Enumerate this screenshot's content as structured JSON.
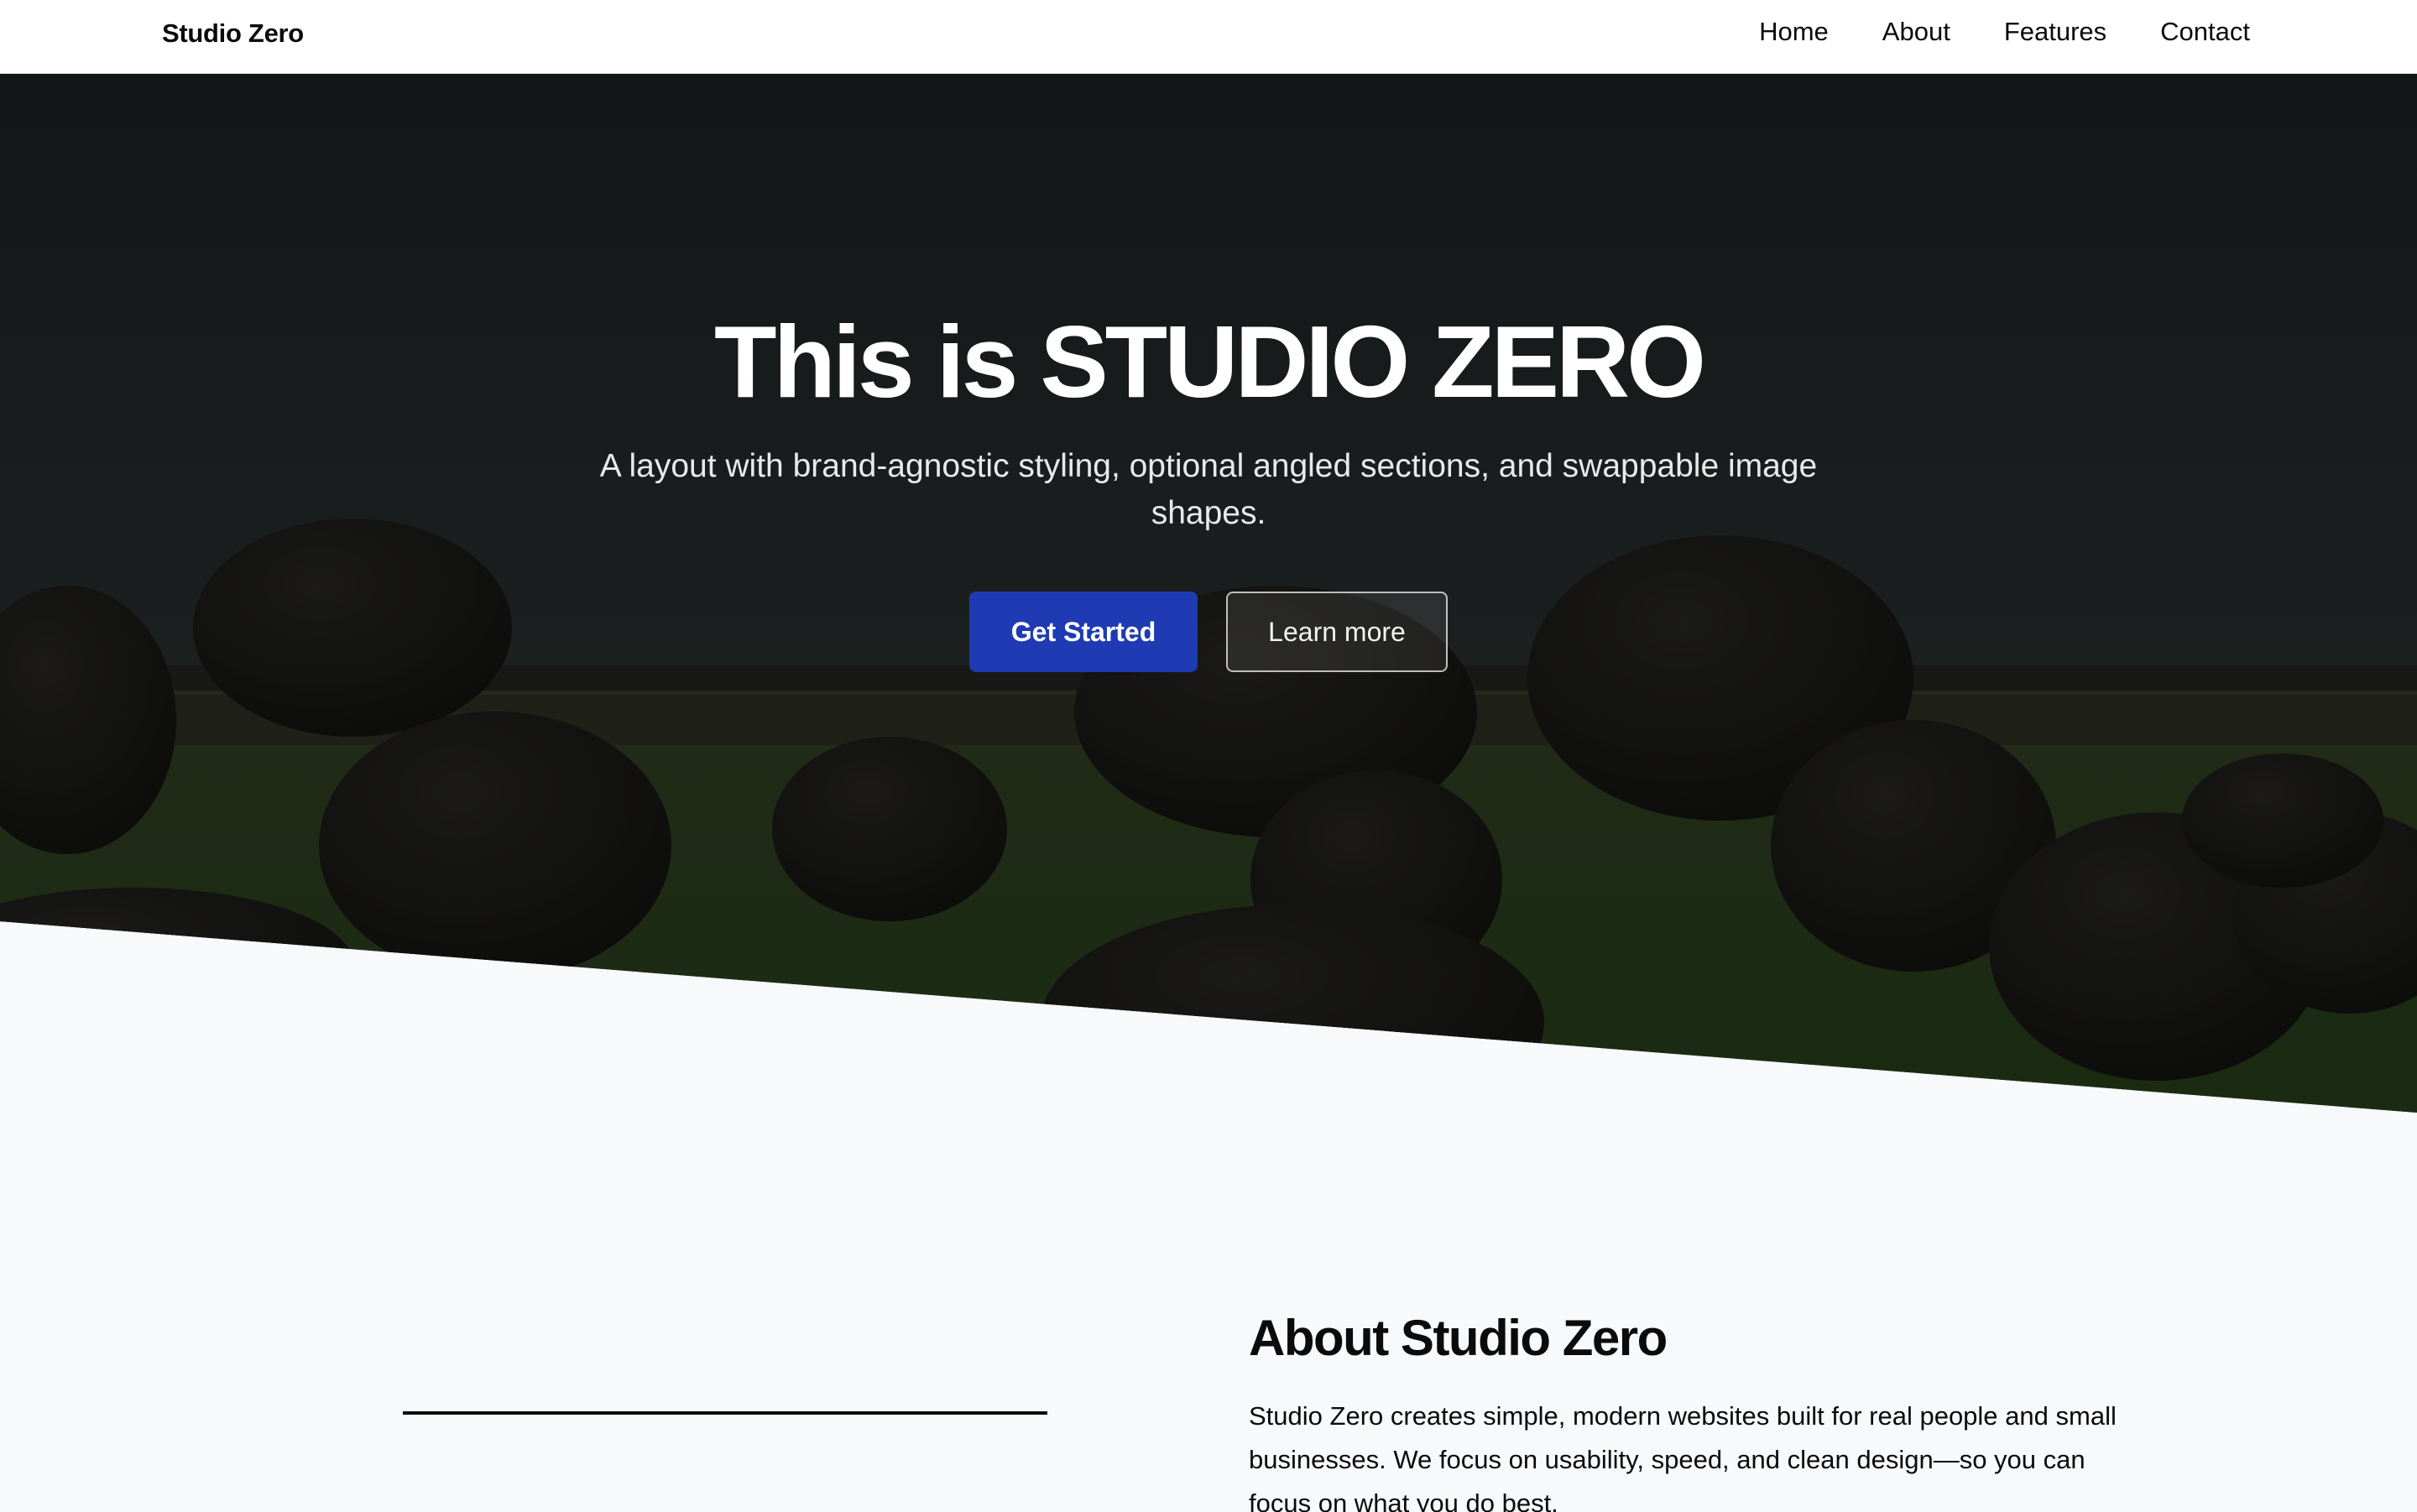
{
  "nav": {
    "brand": "Studio Zero",
    "links": [
      "Home",
      "About",
      "Features",
      "Contact"
    ]
  },
  "hero": {
    "title": "This is STUDIO ZERO",
    "subtitle": "A layout with brand-agnostic styling, optional angled sections, and swappable image shapes.",
    "primary_button": "Get Started",
    "secondary_button": "Learn more"
  },
  "about": {
    "title": "About Studio Zero",
    "text": "Studio Zero creates simple, modern websites built for real people and small businesses. We focus on usability, speed, and clean design—so you can focus on what you do best."
  },
  "colors": {
    "primary": "#1f3bb3",
    "background": "#f8f9fb",
    "text": "#0b0b0b"
  }
}
